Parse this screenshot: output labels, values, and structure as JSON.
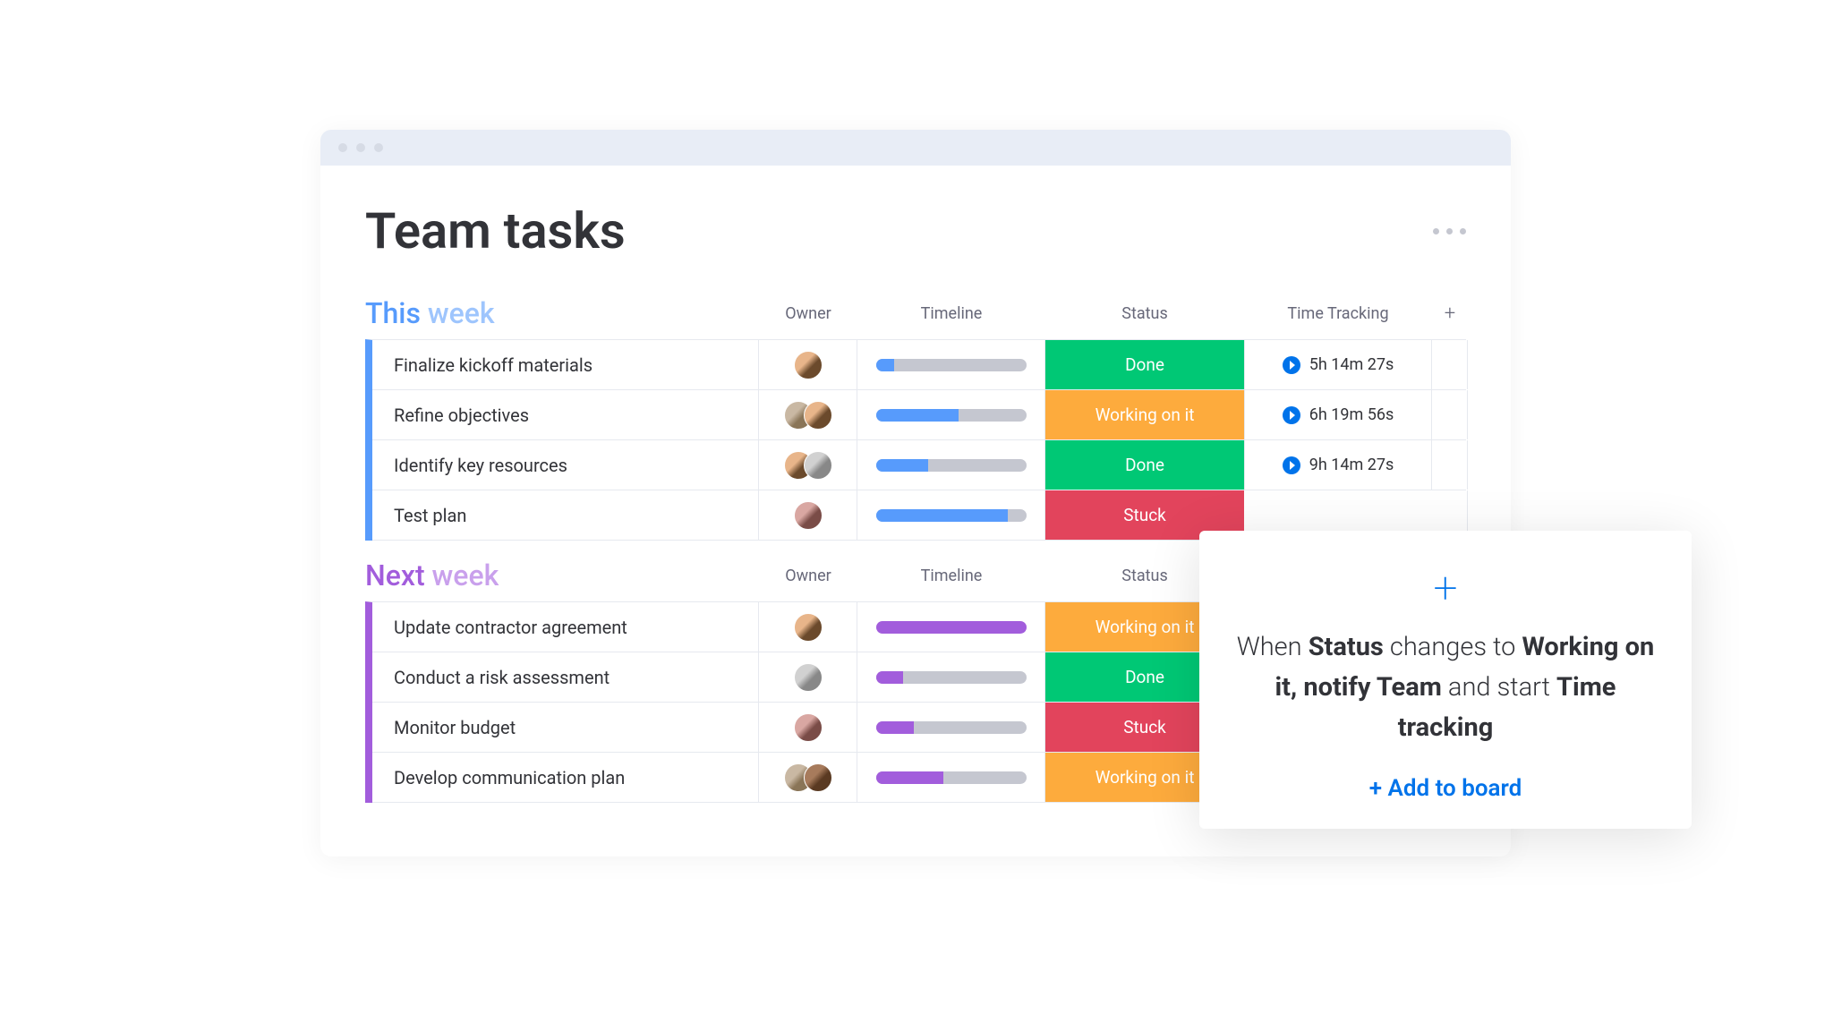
{
  "page": {
    "title": "Team tasks"
  },
  "columns": {
    "owner": "Owner",
    "timeline": "Timeline",
    "status": "Status",
    "time_tracking": "Time Tracking",
    "add": "+"
  },
  "status_labels": {
    "done": "Done",
    "working": "Working on it",
    "stuck": "Stuck"
  },
  "groups": [
    {
      "title_main": "This",
      "title_light": "week",
      "color": "blue",
      "rows": [
        {
          "name": "Finalize kickoff materials",
          "owners": [
            "a1"
          ],
          "progress": 12,
          "status": "done",
          "time": "5h 14m 27s"
        },
        {
          "name": "Refine objectives",
          "owners": [
            "a2",
            "a1"
          ],
          "progress": 55,
          "status": "working",
          "time": "6h 19m 56s"
        },
        {
          "name": "Identify key resources",
          "owners": [
            "a1",
            "a4"
          ],
          "progress": 35,
          "status": "done",
          "time": "9h 14m 27s"
        },
        {
          "name": "Test plan",
          "owners": [
            "a3"
          ],
          "progress": 88,
          "status": "stuck",
          "time": ""
        }
      ]
    },
    {
      "title_main": "Next",
      "title_light": "week",
      "color": "purple",
      "rows": [
        {
          "name": "Update contractor agreement",
          "owners": [
            "a1"
          ],
          "progress": 100,
          "status": "working",
          "time": ""
        },
        {
          "name": "Conduct a risk assessment",
          "owners": [
            "a4"
          ],
          "progress": 18,
          "status": "done",
          "time": ""
        },
        {
          "name": "Monitor budget",
          "owners": [
            "a3"
          ],
          "progress": 25,
          "status": "stuck",
          "time": ""
        },
        {
          "name": "Develop communication plan",
          "owners": [
            "a2",
            "a5"
          ],
          "progress": 45,
          "status": "working",
          "time": ""
        }
      ]
    }
  ],
  "automation": {
    "text_parts": {
      "p1": "When ",
      "b1": "Status",
      "p2": " changes to ",
      "b2": "Working on it, notify Team",
      "p3": " and start ",
      "b3": "Time tracking"
    },
    "action": "+ Add to board"
  }
}
